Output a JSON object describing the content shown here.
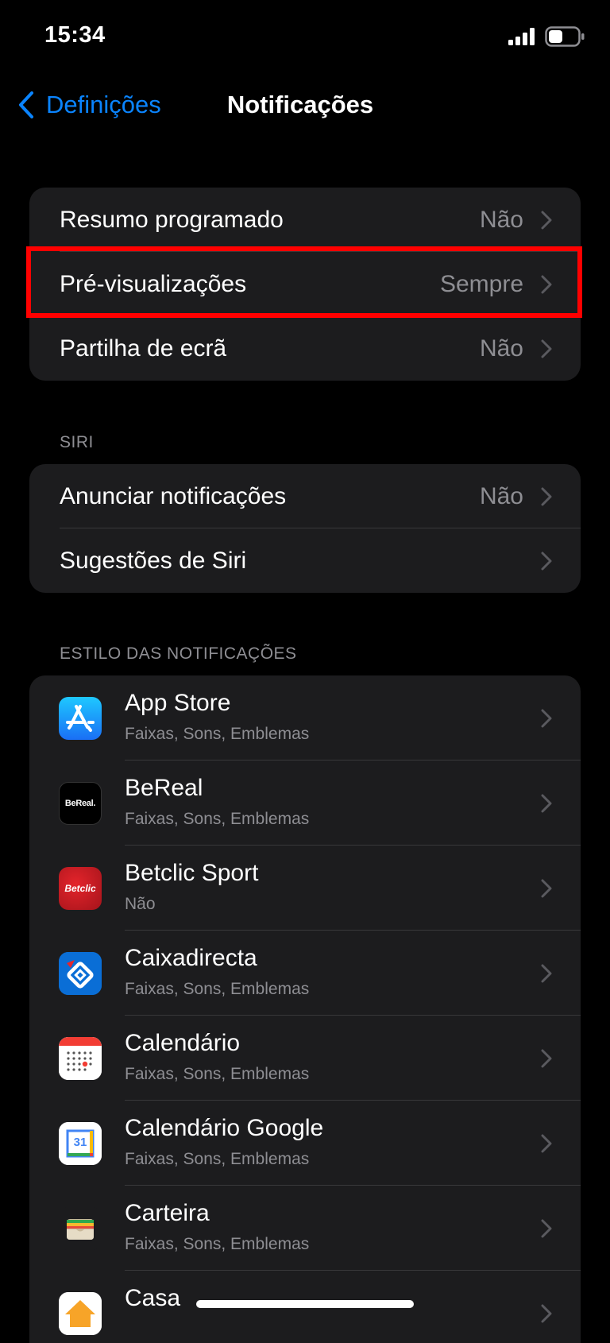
{
  "status_bar": {
    "time": "15:34",
    "signal_icon": "signal-bars-icon",
    "battery_icon": "battery-icon"
  },
  "nav": {
    "back_label": "Definições",
    "title": "Notificações"
  },
  "colors": {
    "accent": "#0a84ff",
    "highlight": "#ff0000",
    "group_bg": "#1c1c1e",
    "secondary_text": "#8e8e93"
  },
  "general": [
    {
      "label": "Resumo programado",
      "value": "Não"
    },
    {
      "label": "Pré-visualizações",
      "value": "Sempre"
    },
    {
      "label": "Partilha de ecrã",
      "value": "Não"
    }
  ],
  "siri": {
    "header": "SIRI",
    "items": [
      {
        "label": "Anunciar notificações",
        "value": "Não"
      },
      {
        "label": "Sugestões de Siri",
        "value": ""
      }
    ]
  },
  "style": {
    "header": "ESTILO DAS NOTIFICAÇÕES",
    "apps": [
      {
        "name": "App Store",
        "sub": "Faixas, Sons, Emblemas",
        "icon": "app-store-icon"
      },
      {
        "name": "BeReal",
        "sub": "Faixas, Sons, Emblemas",
        "icon": "bereal-icon",
        "icon_text": "BeReal."
      },
      {
        "name": "Betclic Sport",
        "sub": "Não",
        "icon": "betclic-icon",
        "icon_text": "Betclic"
      },
      {
        "name": "Caixadirecta",
        "sub": "Faixas, Sons, Emblemas",
        "icon": "caixadirecta-icon"
      },
      {
        "name": "Calendário",
        "sub": "Faixas, Sons, Emblemas",
        "icon": "calendar-icon"
      },
      {
        "name": "Calendário Google",
        "sub": "Faixas, Sons, Emblemas",
        "icon": "google-calendar-icon",
        "icon_text": "31"
      },
      {
        "name": "Carteira",
        "sub": "Faixas, Sons, Emblemas",
        "icon": "wallet-icon"
      },
      {
        "name": "Casa",
        "sub": "",
        "icon": "home-app-icon"
      }
    ]
  }
}
